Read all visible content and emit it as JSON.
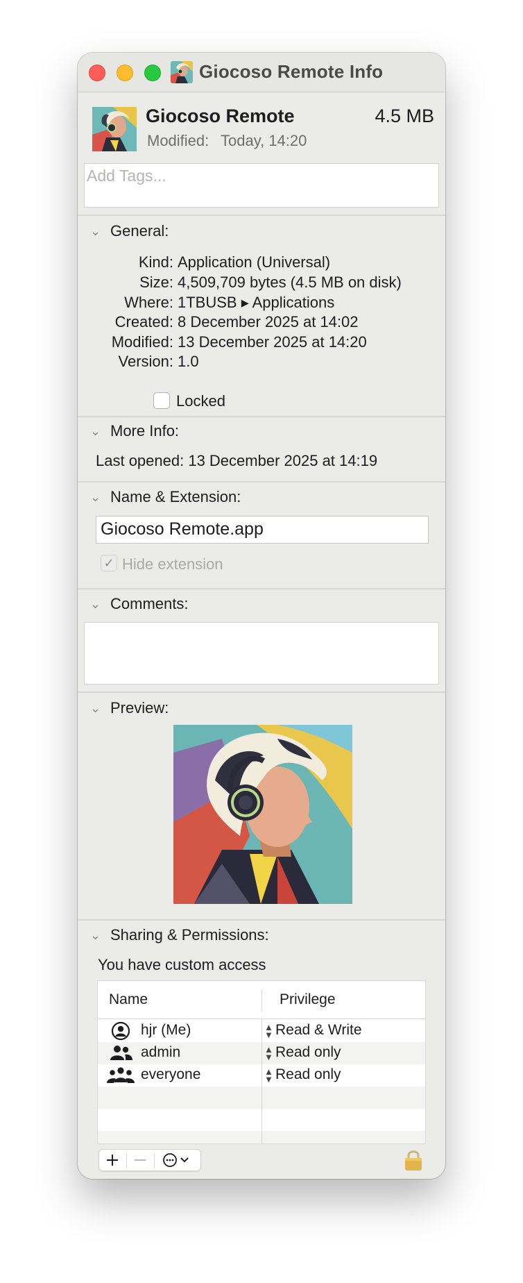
{
  "window": {
    "title": "Giocoso Remote Info"
  },
  "header": {
    "app_name": "Giocoso Remote",
    "size": "4.5 MB",
    "modified_label": "Modified:",
    "modified_value": "Today, 14:20"
  },
  "tags": {
    "placeholder": "Add Tags..."
  },
  "general": {
    "title": "General:",
    "rows": [
      {
        "label": "Kind:",
        "value": "Application (Universal)"
      },
      {
        "label": "Size:",
        "value": "4,509,709 bytes (4.5 MB on disk)"
      },
      {
        "label": "Where:",
        "value": "1TBUSB ▸ Applications"
      },
      {
        "label": "Created:",
        "value": "8 December 2025 at 14:02"
      },
      {
        "label": "Modified:",
        "value": "13 December 2025 at 14:20"
      },
      {
        "label": "Version:",
        "value": "1.0"
      }
    ],
    "locked_label": "Locked",
    "locked": false
  },
  "more_info": {
    "title": "More Info:",
    "last_opened": "Last opened: 13 December 2025 at 14:19"
  },
  "name_extension": {
    "title": "Name & Extension:",
    "filename": "Giocoso Remote.app",
    "hide_extension_label": "Hide extension",
    "hide_extension": true
  },
  "comments": {
    "title": "Comments:",
    "text": ""
  },
  "preview": {
    "title": "Preview:"
  },
  "sharing": {
    "title": "Sharing & Permissions:",
    "access_text": "You have custom access",
    "columns": [
      "Name",
      "Privilege"
    ],
    "rows": [
      {
        "name": "hjr (Me)",
        "privilege": "Read & Write",
        "icon": "user-icon"
      },
      {
        "name": "admin",
        "privilege": "Read only",
        "icon": "group-icon"
      },
      {
        "name": "everyone",
        "privilege": "Read only",
        "icon": "everyone-icon"
      }
    ]
  },
  "toolbar": {
    "add_icon": "plus-icon",
    "remove_icon": "minus-icon",
    "action_icon": "ellipsis-circle-icon",
    "lock_icon": "lock-icon"
  },
  "colors": {
    "close": "#ff5f57",
    "minimize": "#febc2e",
    "maximize": "#28c840",
    "window_bg": "#ebebe7"
  }
}
